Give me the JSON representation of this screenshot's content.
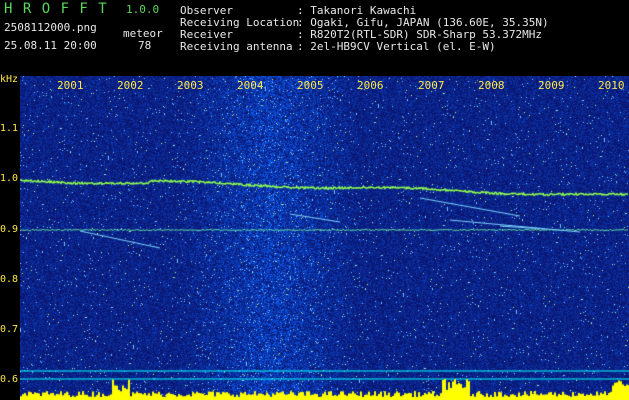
{
  "app": {
    "title": "H R O F F T",
    "version": "1.0.0"
  },
  "file": {
    "name": "2508112000.png",
    "datetime": "25.08.11 20:00"
  },
  "meteor": {
    "label": "meteor",
    "count": "78"
  },
  "info": {
    "labels": [
      "Observer",
      "Receiving Location",
      "Receiver",
      "Receiving antenna"
    ],
    "values": [
      ": Takanori Kawachi",
      ": Ogaki, Gifu, JAPAN (136.60E, 35.35N)",
      ": R820T2(RTL-SDR) SDR-Sharp 53.372MHz",
      ": 2el-HB9CV Vertical (el. E-W)"
    ]
  },
  "chart_data": {
    "type": "heatmap",
    "ylabel": "kHz",
    "y_ticks": [
      "1.1",
      "1.0",
      "0.9",
      "0.8",
      "0.7",
      "0.6"
    ],
    "x_ticks": [
      "2001",
      "2002",
      "2003",
      "2004",
      "2005",
      "2006",
      "2007",
      "2008",
      "2009",
      "2010"
    ],
    "ylim": [
      0.58,
      1.17
    ]
  },
  "colors": {
    "background": "#000000",
    "spectrum": "#0a1a8a",
    "trace": "#8fff4a",
    "bars": "#ffff00",
    "baseline": "#00ffff"
  }
}
